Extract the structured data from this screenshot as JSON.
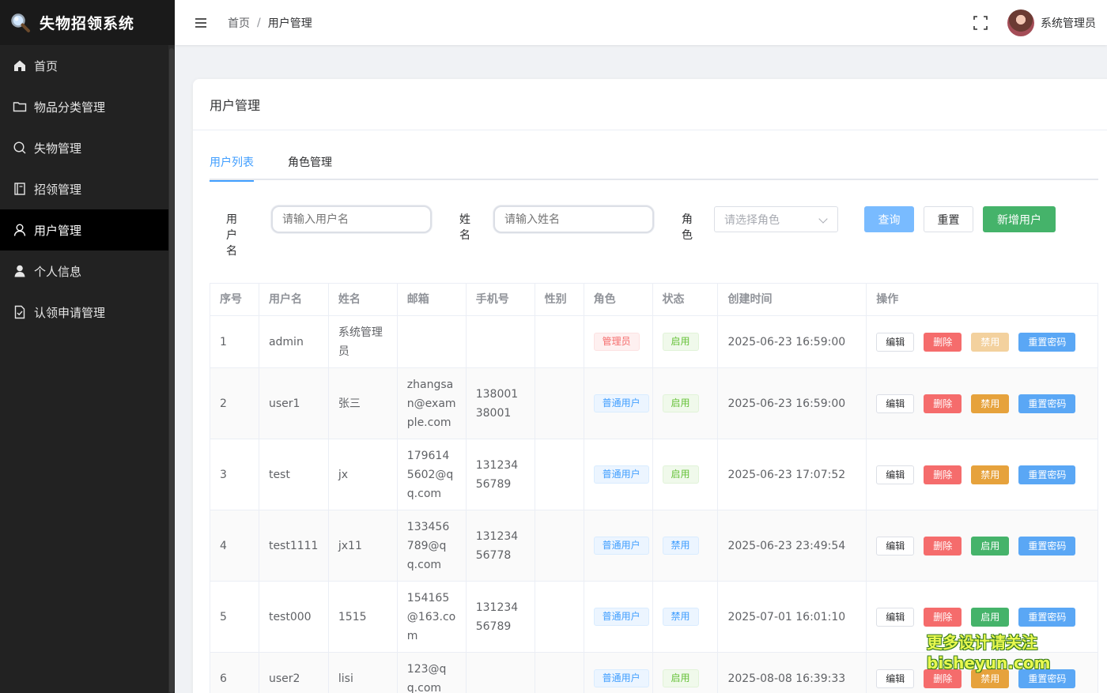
{
  "app": {
    "title": "失物招领系统"
  },
  "sidebar": {
    "items": [
      {
        "label": "首页",
        "icon": "home-icon"
      },
      {
        "label": "物品分类管理",
        "icon": "folder-icon"
      },
      {
        "label": "失物管理",
        "icon": "search-icon"
      },
      {
        "label": "招领管理",
        "icon": "notebook-icon"
      },
      {
        "label": "用户管理",
        "icon": "user-icon",
        "active": true
      },
      {
        "label": "个人信息",
        "icon": "user-filled-icon"
      },
      {
        "label": "认领申请管理",
        "icon": "document-check-icon"
      }
    ]
  },
  "header": {
    "breadcrumb": [
      "首页",
      "用户管理"
    ],
    "breadcrumb_sep": "/",
    "username": "系统管理员"
  },
  "card": {
    "title": "用户管理"
  },
  "tabs": [
    {
      "label": "用户列表",
      "active": true
    },
    {
      "label": "角色管理"
    }
  ],
  "filters": {
    "username_label": "用户名",
    "username_placeholder": "请输入用户名",
    "name_label": "姓名",
    "name_placeholder": "请输入姓名",
    "role_label": "角色",
    "role_placeholder": "请选择角色",
    "query": "查询",
    "reset": "重置",
    "add": "新增用户"
  },
  "table": {
    "headers": [
      "序号",
      "用户名",
      "姓名",
      "邮箱",
      "手机号",
      "性别",
      "角色",
      "状态",
      "创建时间",
      "操作"
    ],
    "ops": {
      "edit": "编辑",
      "delete": "删除",
      "disable": "禁用",
      "enable": "启用",
      "reset_pwd": "重置密码"
    },
    "rows": [
      {
        "no": "1",
        "username": "admin",
        "name": "系统管理员",
        "email": "",
        "phone": "",
        "gender": "",
        "role": "管理员",
        "status": "启用",
        "created": "2025-06-23 16:59:00"
      },
      {
        "no": "2",
        "username": "user1",
        "name": "张三",
        "email": "zhangsan@example.com",
        "phone": "13800138001",
        "gender": "",
        "role": "普通用户",
        "status": "启用",
        "created": "2025-06-23 16:59:00"
      },
      {
        "no": "3",
        "username": "test",
        "name": "jx",
        "email": "1796145602@qq.com",
        "phone": "13123456789",
        "gender": "",
        "role": "普通用户",
        "status": "启用",
        "created": "2025-06-23 17:07:52"
      },
      {
        "no": "4",
        "username": "test1111",
        "name": "jx11",
        "email": "133456789@qq.com",
        "phone": "13123456778",
        "gender": "",
        "role": "普通用户",
        "status": "禁用",
        "created": "2025-06-23 23:49:54"
      },
      {
        "no": "5",
        "username": "test000",
        "name": "1515",
        "email": "154165@163.com",
        "phone": "13123456789",
        "gender": "",
        "role": "普通用户",
        "status": "禁用",
        "created": "2025-07-01 16:01:10"
      },
      {
        "no": "6",
        "username": "user2",
        "name": "lisi",
        "email": "123@qq.com",
        "phone": "",
        "gender": "",
        "role": "普通用户",
        "status": "启用",
        "created": "2025-08-08 16:39:33"
      }
    ]
  },
  "watermark": [
    "更多设计请关注",
    "bisheyun.com"
  ]
}
